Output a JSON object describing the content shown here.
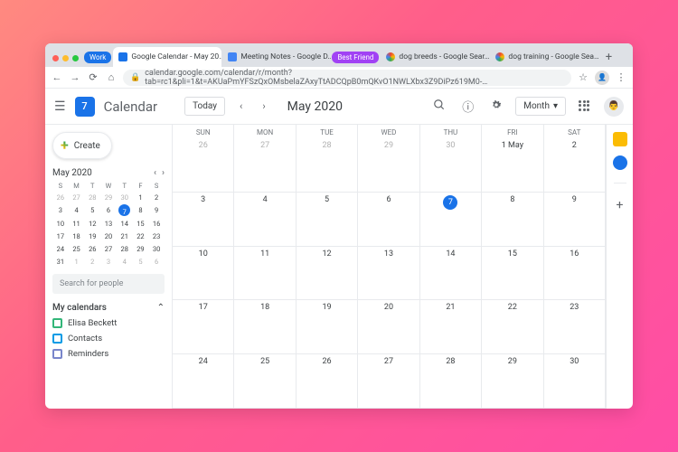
{
  "browser": {
    "groups": [
      {
        "label": "Work",
        "color": "#1a73e8"
      },
      {
        "label": "Best Friend",
        "color": "#a142f4"
      }
    ],
    "tabs": [
      {
        "title": "Google Calendar - May 20…",
        "group": 0,
        "active": true,
        "favicon": "calendar"
      },
      {
        "title": "Meeting Notes - Google D…",
        "group": 0,
        "active": false,
        "favicon": "docs"
      },
      {
        "title": "dog breeds - Google Sear…",
        "group": 1,
        "active": false,
        "favicon": "google"
      },
      {
        "title": "dog training - Google Sea…",
        "group": 1,
        "active": false,
        "favicon": "google"
      }
    ],
    "url": "calendar.google.com/calendar/r/month?tab=rc1&pli=1&t=AKUaPmYFSzQxOMsbelaZAxyTtADCQpB0mQKvO1NWLXbx3Z9DiPz619M0-…"
  },
  "app": {
    "logo_day": "7",
    "title": "Calendar",
    "today_btn": "Today",
    "month_label": "May 2020",
    "view_label": "Month"
  },
  "sidebar": {
    "create": "Create",
    "mini_month": "May 2020",
    "mini_dow": [
      "S",
      "M",
      "T",
      "W",
      "T",
      "F",
      "S"
    ],
    "mini_weeks": [
      [
        {
          "n": "26",
          "dim": true
        },
        {
          "n": "27",
          "dim": true
        },
        {
          "n": "28",
          "dim": true
        },
        {
          "n": "29",
          "dim": true
        },
        {
          "n": "30",
          "dim": true
        },
        {
          "n": "1"
        },
        {
          "n": "2"
        }
      ],
      [
        {
          "n": "3"
        },
        {
          "n": "4"
        },
        {
          "n": "5"
        },
        {
          "n": "6"
        },
        {
          "n": "7",
          "today": true
        },
        {
          "n": "8"
        },
        {
          "n": "9"
        }
      ],
      [
        {
          "n": "10"
        },
        {
          "n": "11"
        },
        {
          "n": "12"
        },
        {
          "n": "13"
        },
        {
          "n": "14"
        },
        {
          "n": "15"
        },
        {
          "n": "16"
        }
      ],
      [
        {
          "n": "17"
        },
        {
          "n": "18"
        },
        {
          "n": "19"
        },
        {
          "n": "20"
        },
        {
          "n": "21"
        },
        {
          "n": "22"
        },
        {
          "n": "23"
        }
      ],
      [
        {
          "n": "24"
        },
        {
          "n": "25"
        },
        {
          "n": "26"
        },
        {
          "n": "27"
        },
        {
          "n": "28"
        },
        {
          "n": "29"
        },
        {
          "n": "30"
        }
      ],
      [
        {
          "n": "31"
        },
        {
          "n": "1",
          "dim": true
        },
        {
          "n": "2",
          "dim": true
        },
        {
          "n": "3",
          "dim": true
        },
        {
          "n": "4",
          "dim": true
        },
        {
          "n": "5",
          "dim": true
        },
        {
          "n": "6",
          "dim": true
        }
      ]
    ],
    "search_placeholder": "Search for people",
    "my_cal_title": "My calendars",
    "calendars": [
      {
        "label": "Elisa Beckett",
        "color": "#33b679"
      },
      {
        "label": "Contacts",
        "color": "#039be5"
      },
      {
        "label": "Reminders",
        "color": "#7986cb"
      }
    ]
  },
  "grid": {
    "dow": [
      "SUN",
      "MON",
      "TUE",
      "WED",
      "THU",
      "FRI",
      "SAT"
    ],
    "weeks": [
      [
        {
          "n": "26",
          "dim": true
        },
        {
          "n": "27",
          "dim": true
        },
        {
          "n": "28",
          "dim": true
        },
        {
          "n": "29",
          "dim": true
        },
        {
          "n": "30",
          "dim": true
        },
        {
          "n": "1 May",
          "first": true
        },
        {
          "n": "2"
        }
      ],
      [
        {
          "n": "3"
        },
        {
          "n": "4"
        },
        {
          "n": "5"
        },
        {
          "n": "6"
        },
        {
          "n": "7",
          "today": true
        },
        {
          "n": "8"
        },
        {
          "n": "9"
        }
      ],
      [
        {
          "n": "10"
        },
        {
          "n": "11"
        },
        {
          "n": "12"
        },
        {
          "n": "13"
        },
        {
          "n": "14"
        },
        {
          "n": "15"
        },
        {
          "n": "16"
        }
      ],
      [
        {
          "n": "17"
        },
        {
          "n": "18"
        },
        {
          "n": "19"
        },
        {
          "n": "20"
        },
        {
          "n": "21"
        },
        {
          "n": "22"
        },
        {
          "n": "23"
        }
      ],
      [
        {
          "n": "24"
        },
        {
          "n": "25"
        },
        {
          "n": "26"
        },
        {
          "n": "27"
        },
        {
          "n": "28"
        },
        {
          "n": "29"
        },
        {
          "n": "30"
        }
      ]
    ]
  }
}
